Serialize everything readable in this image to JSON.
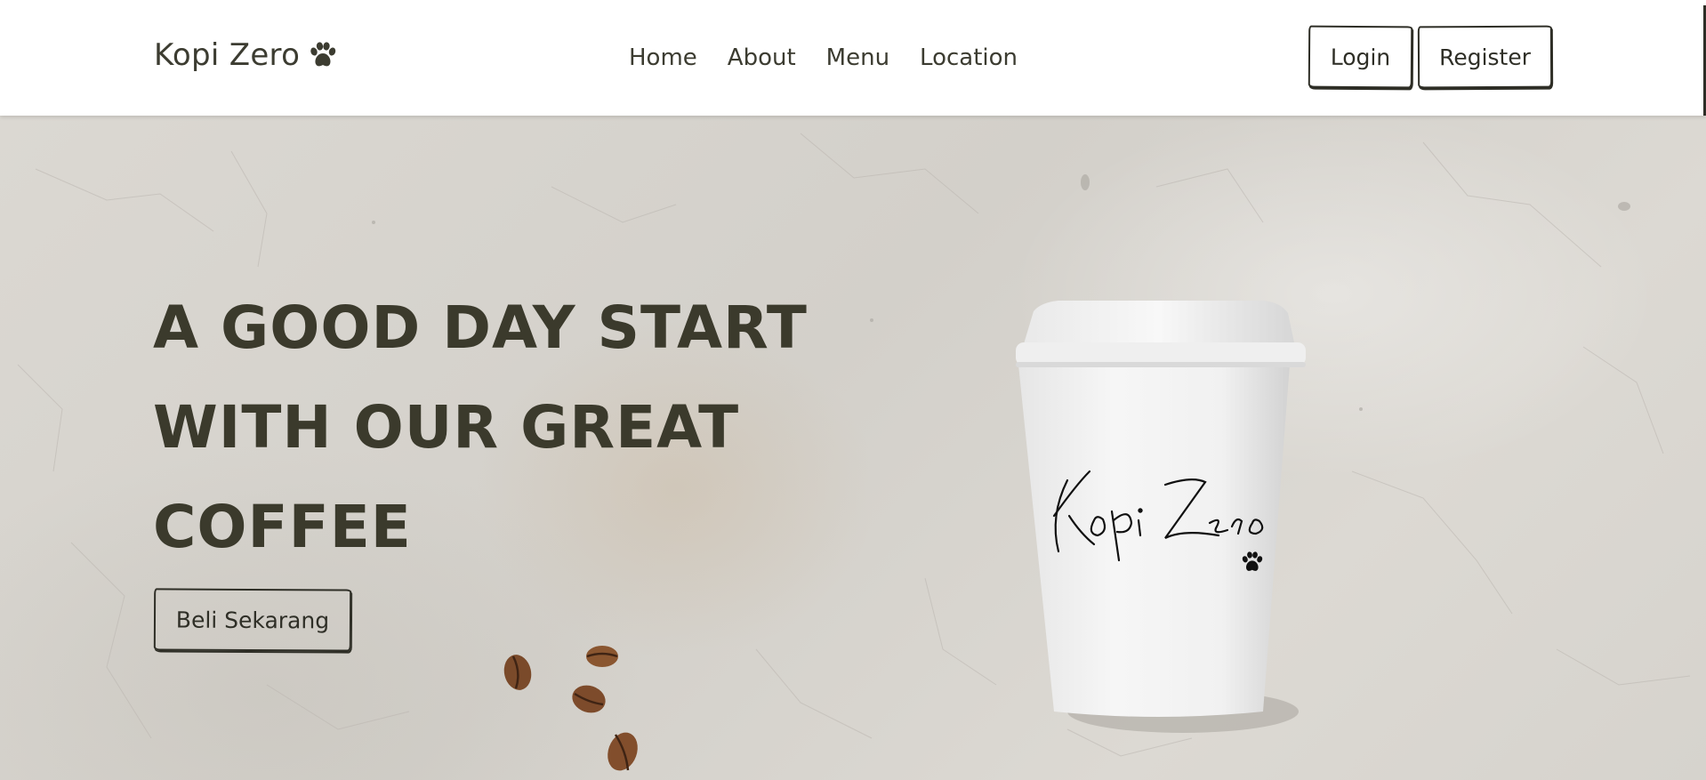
{
  "brand": {
    "name": "Kopi Zero",
    "icon": "paw-icon"
  },
  "nav": {
    "links": [
      "Home",
      "About",
      "Menu",
      "Location"
    ]
  },
  "auth": {
    "login_label": "Login",
    "register_label": "Register"
  },
  "hero": {
    "headline_lines": [
      "A GOOD DAY START",
      "WITH OUR GREAT",
      "COFFEE"
    ],
    "cta_label": "Beli Sekarang",
    "cup_logo_text": "Kopi Zero",
    "cup_logo_icon": "paw-icon",
    "decoration": "coffee-beans"
  },
  "colors": {
    "text_dark": "#3b3a2c",
    "nav_text": "#3c3c31",
    "background": "#d8d5cf",
    "navbar_bg": "#ffffff",
    "border": "#2e2e26"
  }
}
